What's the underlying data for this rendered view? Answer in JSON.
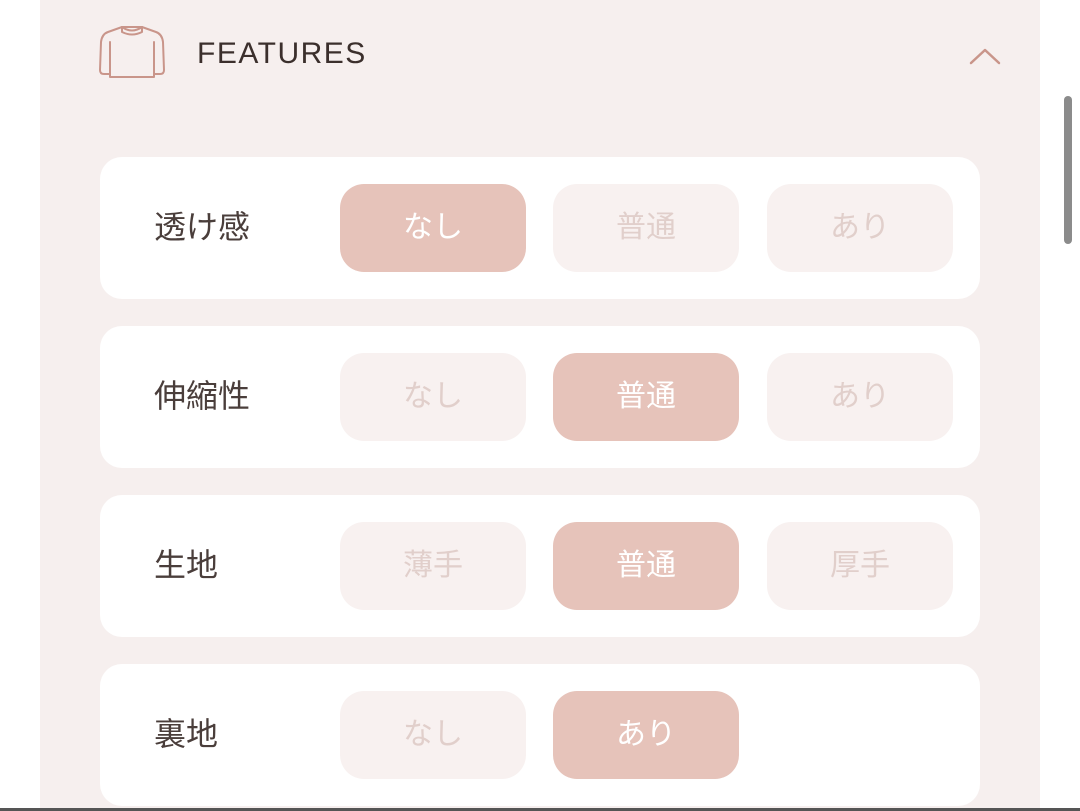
{
  "header": {
    "title": "FEATURES",
    "icon": "shirt-icon",
    "collapse_icon": "chevron-up-icon"
  },
  "colors": {
    "panel_background": "#f6efee",
    "selected_option": "#e6c3ba",
    "unselected_option": "#f8f1f0",
    "accent": "#c9958a"
  },
  "features": [
    {
      "label": "透け感",
      "options": [
        "なし",
        "普通",
        "あり"
      ],
      "selected": "なし"
    },
    {
      "label": "伸縮性",
      "options": [
        "なし",
        "普通",
        "あり"
      ],
      "selected": "普通"
    },
    {
      "label": "生地",
      "options": [
        "薄手",
        "普通",
        "厚手"
      ],
      "selected": "普通"
    },
    {
      "label": "裏地",
      "options": [
        "なし",
        "あり"
      ],
      "selected": "あり"
    }
  ]
}
